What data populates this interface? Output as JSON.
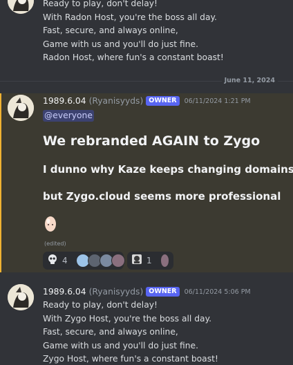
{
  "message_top": {
    "lines": [
      "Ready to play, don't delay!",
      "With Radon Host, you're the boss all day.",
      "Fast, secure, and always online,",
      "Game with us and you'll do just fine.",
      "Radon Host, where fun's a constant boast!"
    ]
  },
  "date_divider": "June 11, 2024",
  "message_main": {
    "username": "1989.6.04",
    "handle": "(Ryanisyyds)",
    "role_badge": "OWNER",
    "timestamp": "06/11/2024 1:21 PM",
    "mention": "@everyone",
    "heading": "We rebranded AGAIN to Zygo",
    "subheading_1": "I dunno why Kaze keeps changing domains",
    "subheading_2": "but Zygo.cloud seems more professional",
    "edited_label": "(edited)",
    "reactions": [
      {
        "emoji": "skull-emoji",
        "count": "4"
      },
      {
        "emoji": "custom-avatar-emoji",
        "count": "1"
      }
    ]
  },
  "message_bottom": {
    "username": "1989.6.04",
    "handle": "(Ryanisyyds)",
    "role_badge": "OWNER",
    "timestamp": "06/11/2024 5:06 PM",
    "lines": [
      "Ready to play, don't delay!",
      "With Zygo Host, you're the boss all day.",
      "Fast, secure, and always online,",
      "Game with us and you'll do just fine.",
      "Zygo Host, where fun's a constant boast!"
    ]
  },
  "colors": {
    "background": "#313338",
    "highlight_bg": "#3c3a31",
    "highlight_bar": "#f0b232",
    "owner_badge": "#5865f2",
    "mention_bg": "#3c4270"
  }
}
